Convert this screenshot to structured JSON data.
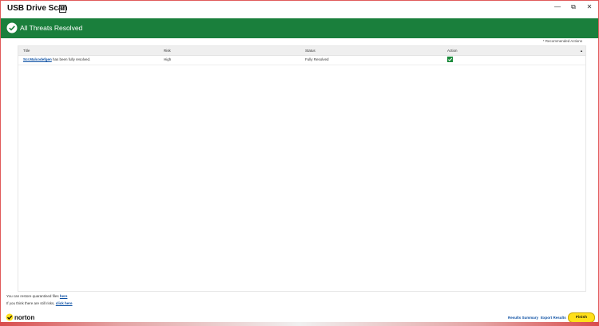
{
  "window": {
    "title": "USB Drive Scan",
    "help_icon_label": "?"
  },
  "banner": {
    "text": "All Threats Resolved",
    "color": "#1a7f3c"
  },
  "recommended_actions": "* Recommended Actions",
  "table": {
    "headers": [
      "Title",
      "Risk",
      "Status",
      "Action"
    ],
    "rows": [
      {
        "title_link": "Scr.Malcodefgen",
        "title_suffix": " has been fully resolved.",
        "risk": "High",
        "status": "Fully Resolved",
        "action_icon": "check-icon"
      }
    ]
  },
  "footer": {
    "restore_prefix": "You can restore quarantined files ",
    "restore_link": "here",
    "risks_prefix": "If you think there are still risks, ",
    "risks_link": "click here",
    "brand": "norton",
    "results_summary": "Results Summary",
    "export_results": "Export Results",
    "finish": "Finish",
    "finish_color": "#ffe01b"
  }
}
